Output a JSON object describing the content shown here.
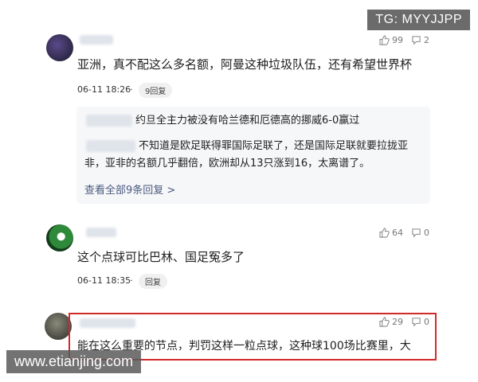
{
  "watermark_top": "TG: MYYJJPP",
  "watermark_bottom": "www.etianjing.com",
  "comments": [
    {
      "text": "亚洲，真不配这么多名额，阿曼这种垃圾队伍，还有希望世界杯",
      "time": "06-11 18:26",
      "separator": "·",
      "reply_label": "9回复",
      "likes": "99",
      "comments_count": "2",
      "replies": [
        {
          "text": "约旦全主力被没有哈兰德和厄德高的挪威6-0赢过"
        },
        {
          "text_line1": "不知道是欧足联得罪国际足联了，还是国际足联就要拉拢亚",
          "text_line2": "非，亚非的名额几乎翻倍，欧洲却从13只涨到16，太离谱了。"
        }
      ],
      "view_all": "查看全部9条回复 >"
    },
    {
      "text": "这个点球可比巴林、国足冤多了",
      "time": "06-11 18:35",
      "separator": "·",
      "reply_label": "回复",
      "likes": "64",
      "comments_count": "0"
    },
    {
      "text": "能在这么重要的节点，判罚这样一粒点球，这种球100场比赛里，大",
      "likes": "29",
      "comments_count": "0"
    }
  ],
  "colors": {
    "highlight_border": "#d12a2a",
    "link": "#4a5a80"
  }
}
